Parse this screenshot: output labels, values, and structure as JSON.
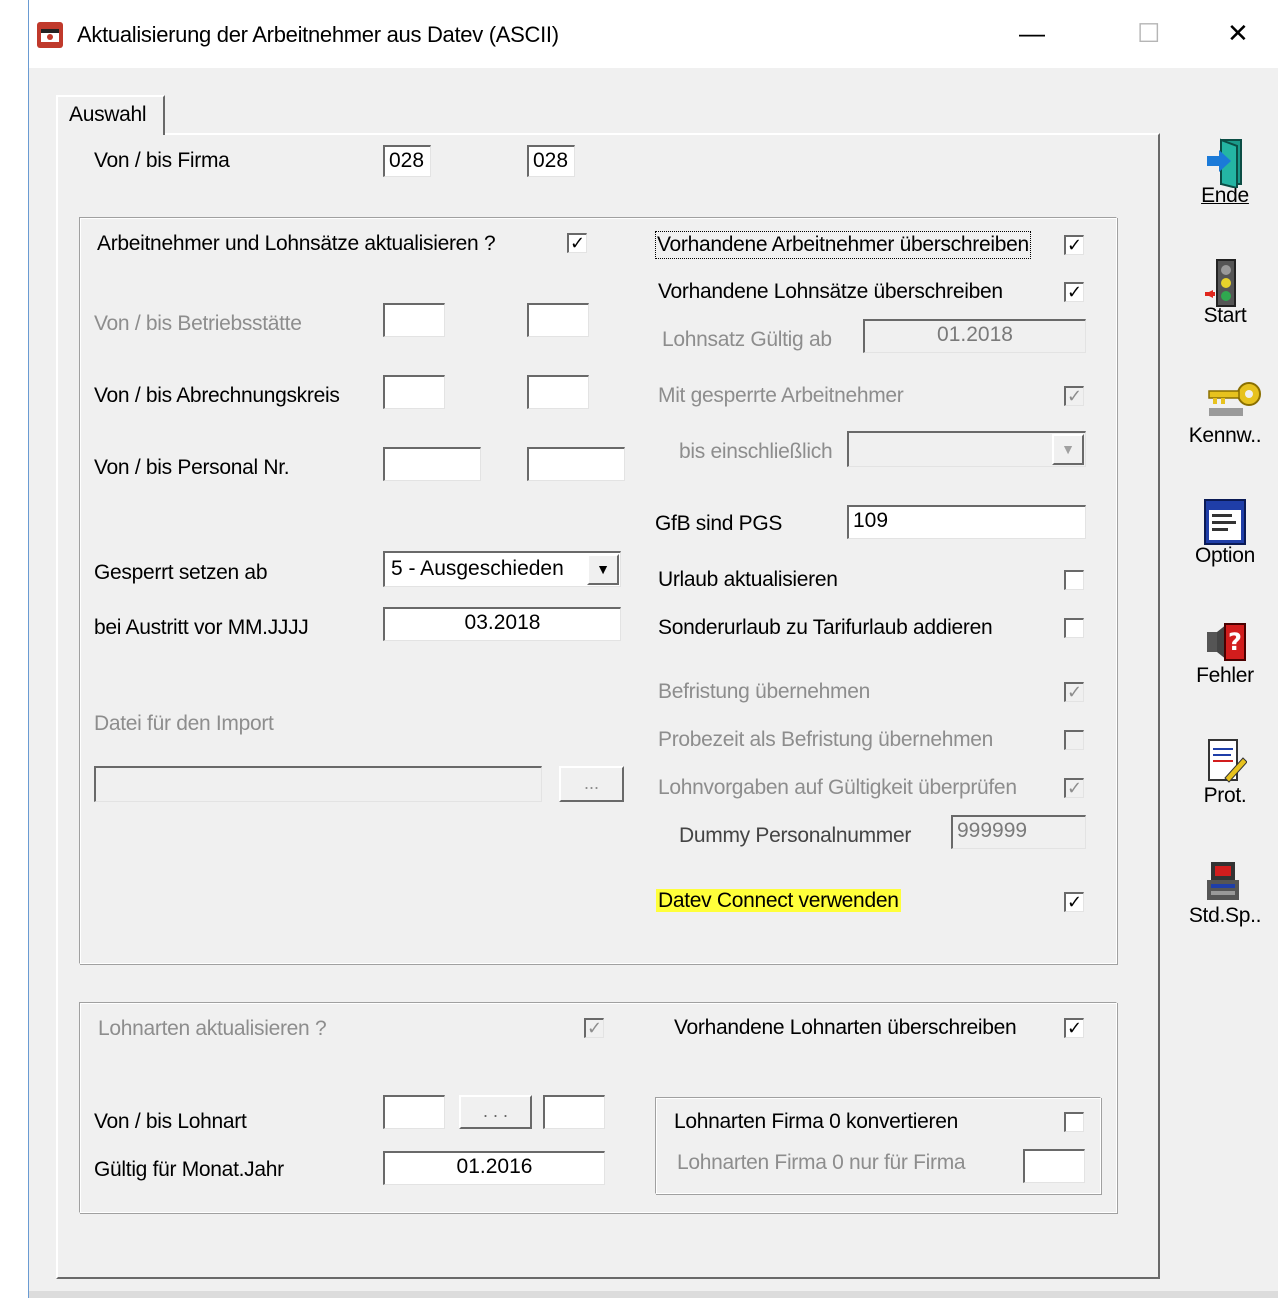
{
  "window": {
    "title": "Aktualisierung der Arbeitnehmer aus Datev (ASCII)",
    "minimize": "—",
    "maximize": "☐",
    "close": "✕"
  },
  "tab": {
    "label": "Auswahl"
  },
  "firma": {
    "label": "Von / bis Firma",
    "from": "028",
    "to": "028"
  },
  "group1": {
    "an_lohn_label": "Arbeitnehmer und Lohnsätze aktualisieren ?",
    "an_lohn_checked": "✓",
    "betriebsstaette_label": "Von / bis Betriebsstätte",
    "abrechnungskreis_label": "Von / bis Abrechnungskreis",
    "personal_label": "Von / bis Personal Nr.",
    "gesperrt_label": "Gesperrt setzen ab",
    "gesperrt_value": "5 - Ausgeschieden",
    "austritt_label": "bei Austritt vor MM.JJJJ",
    "austritt_value": "03.2018",
    "datei_label": "Datei für den Import",
    "browse_label": "...",
    "vorh_an_label": "Vorhandene Arbeitnehmer überschreiben",
    "vorh_an_checked": "✓",
    "vorh_lohn_label": "Vorhandene Lohnsätze überschreiben",
    "vorh_lohn_checked": "✓",
    "lohnsatz_gueltig_label": "Lohnsatz Gültig ab",
    "lohnsatz_gueltig_value": "01.2018",
    "gesperrte_an_label": "Mit gesperrte Arbeitnehmer",
    "gesperrte_an_checked": "✓",
    "bis_einschl_label": "bis einschließlich",
    "gfb_label": "GfB sind PGS",
    "gfb_value": "109",
    "urlaub_label": "Urlaub aktualisieren",
    "sonderurlaub_label": "Sonderurlaub zu Tarifurlaub addieren",
    "befristung_label": "Befristung übernehmen",
    "befristung_checked": "✓",
    "probezeit_label": "Probezeit als Befristung übernehmen",
    "lohnvorgaben_label": "Lohnvorgaben auf Gültigkeit überprüfen",
    "lohnvorgaben_checked": "✓",
    "dummy_label": "Dummy Personalnummer",
    "dummy_value": "999999",
    "datev_connect_label": "Datev Connect verwenden",
    "datev_connect_checked": "✓"
  },
  "group2": {
    "lohnarten_label": "Lohnarten aktualisieren ?",
    "lohnarten_checked": "✓",
    "vorh_lohnarten_label": "Vorhandene Lohnarten überschreiben",
    "vorh_lohnarten_checked": "✓",
    "lohnart_label": "Von / bis Lohnart",
    "lohnart_browse": ". . .",
    "gueltig_label": "Gültig für Monat.Jahr",
    "gueltig_value": "01.2016",
    "firma0_konv_label": "Lohnarten Firma 0 konvertieren",
    "firma0_nur_label": "Lohnarten Firma 0 nur für Firma"
  },
  "sidebar": {
    "ende": "Ende",
    "start": "Start",
    "kennw": "Kennw..",
    "option": "Option",
    "fehler": "Fehler",
    "prot": "Prot.",
    "stdsp": "Std.Sp.."
  },
  "colors": {
    "highlight": "#ffff3a",
    "disabled_text": "#8d8d8d",
    "dialog_bg": "#f0f0f0"
  }
}
